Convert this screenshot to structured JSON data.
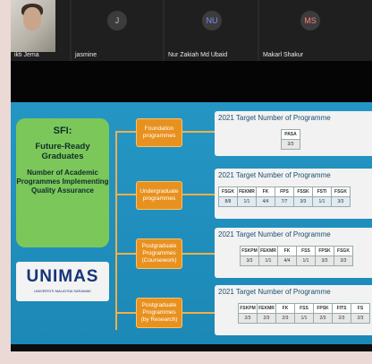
{
  "participants": [
    {
      "name": "ikti Jema",
      "avatar": "",
      "color": "#cfcfcf"
    },
    {
      "name": "jasmine",
      "avatar": "J",
      "color": "#bdbdbd"
    },
    {
      "name": "Nur Zakiah Md Ubaid",
      "avatar": "NU",
      "color": "#7b8cff"
    },
    {
      "name": "Makarl Shakur",
      "avatar": "MS",
      "color": "#ff7b7b"
    }
  ],
  "slide": {
    "sfi_title": "SFI:",
    "sfi_subtitle": "Future-Ready Graduates",
    "sfi_desc": "Number of Academic Programmes Implementing Quality Assurance",
    "logo_text": "UNIMAS",
    "logo_sub": "UNIVERSITI MALAYSIA SARAWAK",
    "categories": [
      {
        "label": "Foundation programmes",
        "heading": "2021 Target Number of Programme",
        "cols": [
          "PASA"
        ],
        "vals": [
          "3/3"
        ]
      },
      {
        "label": "Undergraduate programmes",
        "heading": "2021 Target Number of Programme",
        "cols": [
          "FSGK",
          "FEKMR",
          "FK",
          "FPS",
          "FSSK",
          "FSTI",
          "FSGK"
        ],
        "vals": [
          "8/8",
          "1/1",
          "4/4",
          "7/7",
          "3/3",
          "1/1",
          "3/3"
        ]
      },
      {
        "label": "Postgraduate Programmes (Coursework)",
        "heading": "2021 Target Number of Programme",
        "cols": [
          "FSKPM",
          "FEKMR",
          "FK",
          "FSS",
          "FPSK",
          "FSGK"
        ],
        "vals": [
          "3/3",
          "1/1",
          "4/4",
          "1/1",
          "3/3",
          "3/3"
        ]
      },
      {
        "label": "Postgraduate Programmes (by Research)",
        "heading": "2021 Target Number of Programme",
        "cols": [
          "FSKPM",
          "FEKMR",
          "FK",
          "FSS",
          "FPSK",
          "FITS",
          "FS"
        ],
        "vals": [
          "2/3",
          "2/3",
          "2/3",
          "1/1",
          "2/3",
          "2/3",
          "2/3"
        ]
      }
    ]
  }
}
